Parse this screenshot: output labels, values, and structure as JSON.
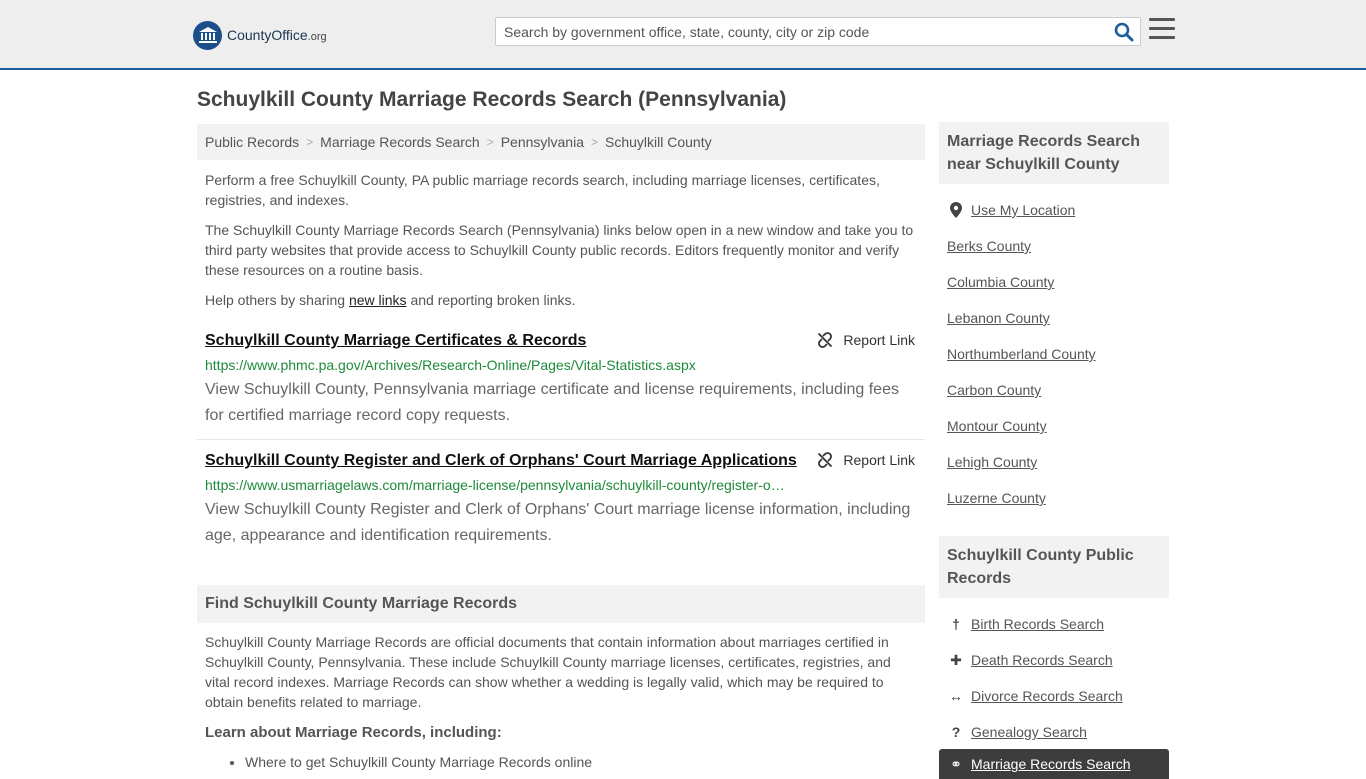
{
  "header": {
    "logo_text": "CountyOffice",
    "logo_tld": ".org",
    "search_placeholder": "Search by government office, state, county, city or zip code"
  },
  "page": {
    "title": "Schuylkill County Marriage Records Search (Pennsylvania)"
  },
  "breadcrumb": [
    "Public Records",
    "Marriage Records Search",
    "Pennsylvania",
    "Schuylkill County"
  ],
  "intro": {
    "p1": "Perform a free Schuylkill County, PA public marriage records search, including marriage licenses, certificates, registries, and indexes.",
    "p2": "The Schuylkill County Marriage Records Search (Pennsylvania) links below open in a new window and take you to third party websites that provide access to Schuylkill County public records. Editors frequently monitor and verify these resources on a routine basis.",
    "p3_before": "Help others by sharing ",
    "p3_link": "new links",
    "p3_after": " and reporting broken links."
  },
  "results": [
    {
      "title": "Schuylkill County Marriage Certificates & Records",
      "url": "https://www.phmc.pa.gov/Archives/Research-Online/Pages/Vital-Statistics.aspx",
      "description": "View Schuylkill County, Pennsylvania marriage certificate and license requirements, including fees for certified marriage record copy requests.",
      "report_label": "Report Link"
    },
    {
      "title": "Schuylkill County Register and Clerk of Orphans' Court Marriage Applications",
      "url": "https://www.usmarriagelaws.com/marriage-license/pennsylvania/schuylkill-county/register-o…",
      "description": "View Schuylkill County Register and Clerk of Orphans' Court marriage license information, including age, appearance and identification requirements.",
      "report_label": "Report Link"
    }
  ],
  "find": {
    "heading": "Find Schuylkill County Marriage Records",
    "text": "Schuylkill County Marriage Records are official documents that contain information about marriages certified in Schuylkill County, Pennsylvania. These include Schuylkill County marriage licenses, certificates, registries, and vital record indexes. Marriage Records can show whether a wedding is legally valid, which may be required to obtain benefits related to marriage.",
    "learn_heading": "Learn about Marriage Records, including:",
    "learn_items": [
      "Where to get Schuylkill County Marriage Records online"
    ]
  },
  "sidebar": {
    "nearby_heading": "Marriage Records Search near Schuylkill County",
    "use_location": "Use My Location",
    "nearby": [
      "Berks County",
      "Columbia County",
      "Lebanon County",
      "Northumberland County",
      "Carbon County",
      "Montour County",
      "Lehigh County",
      "Luzerne County"
    ],
    "public_heading": "Schuylkill County Public Records",
    "public_links": [
      {
        "label": "Birth Records Search",
        "icon": "baby-icon"
      },
      {
        "label": "Death Records Search",
        "icon": "cross-icon"
      },
      {
        "label": "Divorce Records Search",
        "icon": "split-arrows-icon"
      },
      {
        "label": "Genealogy Search",
        "icon": "question-icon"
      }
    ],
    "active_link": {
      "label": "Marriage Records Search",
      "icon": "rings-icon"
    }
  },
  "colors": {
    "accent": "#1c5e9c",
    "url_green": "#1d8a3a",
    "active_bg": "#3d3d3d"
  }
}
